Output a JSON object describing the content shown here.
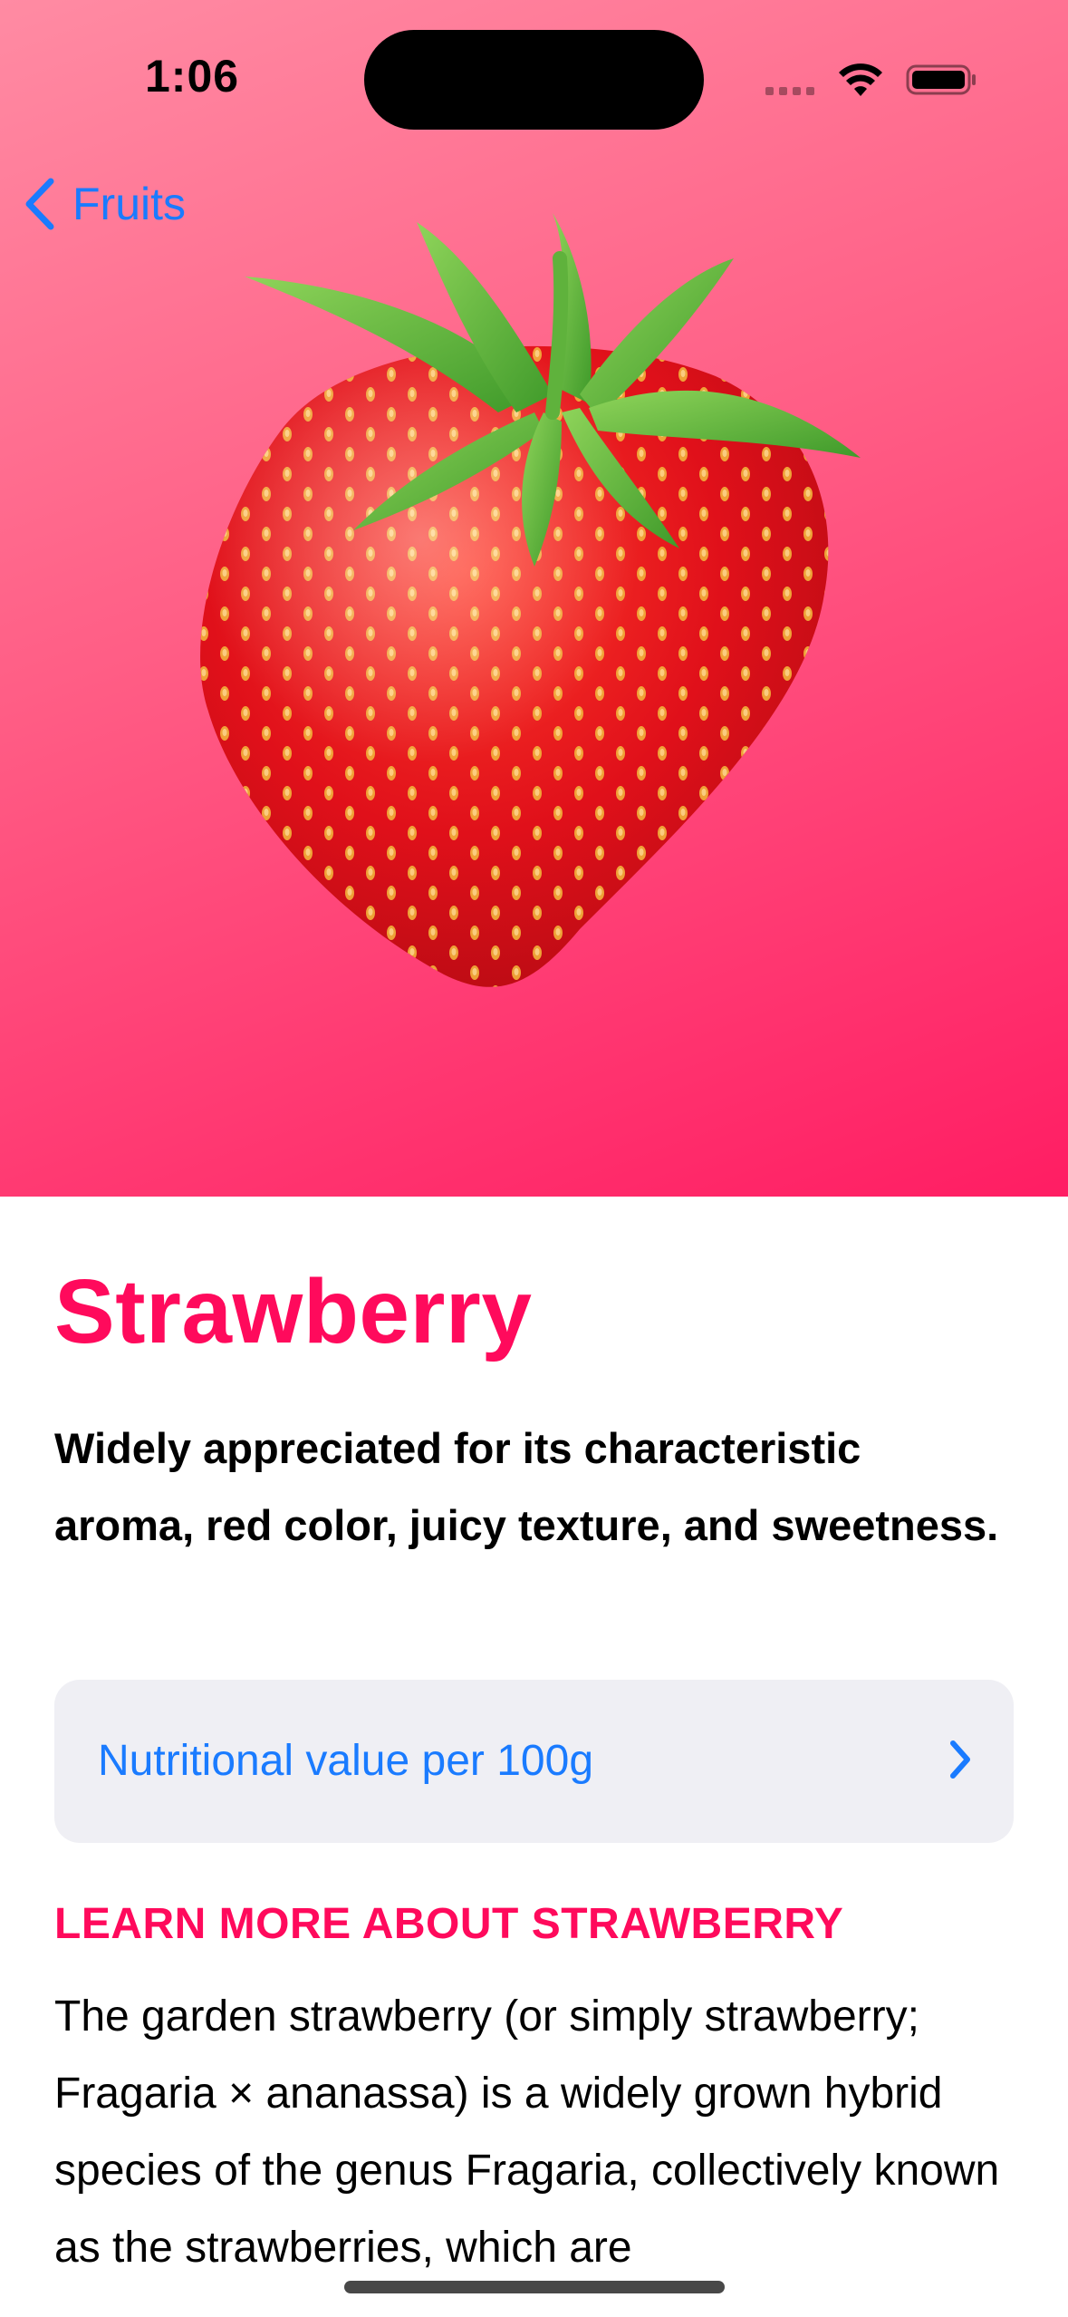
{
  "status_bar": {
    "time": "1:06"
  },
  "nav": {
    "back_label": "Fruits",
    "back_icon": "chevron-left-icon"
  },
  "hero": {
    "image": "strawberry-image",
    "gradient_colors": [
      "#ff8ba3",
      "#ff5d85",
      "#ff1d63"
    ]
  },
  "fruit": {
    "title": "Strawberry",
    "headline": "Widely appreciated for its characteristic aroma,  red color, juicy texture, and sweetness.",
    "nutrition_label": "Nutritional value per 100g",
    "nutrition_icon": "chevron-right-icon",
    "learn_more_heading": "LEARN MORE ABOUT STRAWBERRY",
    "description": "The garden strawberry (or simply strawberry; Fragaria × ananassa) is a widely grown hybrid species of the genus Fragaria, collectively known as the strawberries, which are"
  },
  "colors": {
    "accent": "#ff0a5c",
    "link": "#1a7bff",
    "row_background": "#efeff4"
  }
}
